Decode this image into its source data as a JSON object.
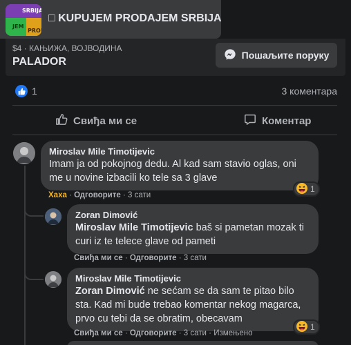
{
  "group": {
    "name": "□ KUPUJEM PRODAJEM SRBIJA",
    "thumb_text": [
      "SRBIJA",
      "JEM",
      "PROD"
    ]
  },
  "listing": {
    "meta": "$4 · КАЊИЖА, ВОЈВОДИНА",
    "title": "PALADOR",
    "message_button": "Пошаљите поруку"
  },
  "stats": {
    "likes": "1",
    "comments": "3 коментара"
  },
  "actions": {
    "like": "Свиђа ми се",
    "comment": "Коментар"
  },
  "colors": {
    "background": "#18191a",
    "bubble": "#3a3b3c",
    "like_blue": "#2078f4",
    "haha_yellow": "#f7b928"
  },
  "comments": [
    {
      "author": "Miroslav Mile Timotijevic",
      "text": "Imam ja od pokojnog dedu. Al kad sam stavio oglas, oni me u novine izbacili ko tele sa 3 glave",
      "reaction_action": "Хаха",
      "reply": "Одговорите",
      "time": "3 сати",
      "reaction_count": "1"
    },
    {
      "author": "Zoran Dimović",
      "mention": "Miroslav Mile Timotijevic",
      "text": " baš si pametan mozak ti curi iz te telece glave od pameti",
      "like": "Свиђа ми се",
      "reply": "Одговорите",
      "time": "3 сати"
    },
    {
      "author": "Miroslav Mile Timotijevic",
      "mention": "Zoran Dimović",
      "text": " ne sećam se da sam te pitao bilo sta. Kad mi bude trebao komentar nekog magarca, prvo cu tebi da se obratim, obecavam",
      "like": "Свиђа ми се",
      "reply": "Одговорите",
      "time": "3 сати",
      "edited": "Измењено",
      "reaction_count": "1"
    }
  ]
}
